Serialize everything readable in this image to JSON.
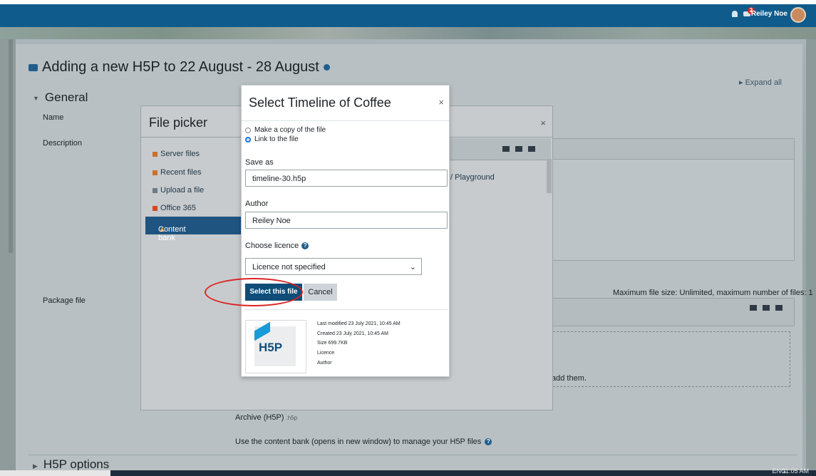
{
  "header": {
    "user_name": "Reiley Noe",
    "notification_count": "2"
  },
  "page": {
    "title": "Adding a new H5P to 22 August - 28 August",
    "expand_all": "Expand all",
    "section_general": "General",
    "labels": {
      "name": "Name",
      "description": "Description",
      "package_file": "Package file"
    },
    "max_file_size": "Maximum file size: Unlimited, maximum number of files: 1",
    "archive_label": "Archive (H5P)",
    "archive_ext": ".h5p",
    "content_bank_note": "Use the content bank (opens in new window) to manage your H5P files",
    "add_them": "add them.",
    "section_h5p_options": "H5P options"
  },
  "file_picker": {
    "title": "File picker",
    "close": "×",
    "repositories": [
      {
        "label": "Server files",
        "icon": "server-files-icon"
      },
      {
        "label": "Recent files",
        "icon": "recent-files-icon"
      },
      {
        "label": "Upload a file",
        "icon": "upload-icon"
      },
      {
        "label": "Office 365",
        "icon": "office365-icon"
      },
      {
        "label": "Content bank",
        "icon": "content-bank-icon"
      }
    ],
    "breadcrumb_fragment": "Playground"
  },
  "dialog": {
    "title": "Select Timeline of Coffee",
    "close": "×",
    "option_copy": "Make a copy of the file",
    "option_link": "Link to the file",
    "save_as_label": "Save as",
    "save_as_value": "timeline-30.h5p",
    "author_label": "Author",
    "author_value": "Reiley Noe",
    "licence_label": "Choose licence",
    "licence_value": "Licence not specified",
    "select_button": "Select this file",
    "cancel_button": "Cancel",
    "meta": {
      "last_modified": "Last modified 23 July 2021, 10:45 AM",
      "created": "Created 23 July 2021, 10:45 AM",
      "size": "Size 699.7KB",
      "licence": "Licence",
      "author": "Author"
    },
    "thumb_logo": "H5P"
  },
  "taskbar": {
    "lang": "ENG",
    "time": "11:05 AM"
  },
  "colors": {
    "header": "#0f5c8c",
    "primary_button": "#0f4d78",
    "annotation": "#dd2222"
  }
}
